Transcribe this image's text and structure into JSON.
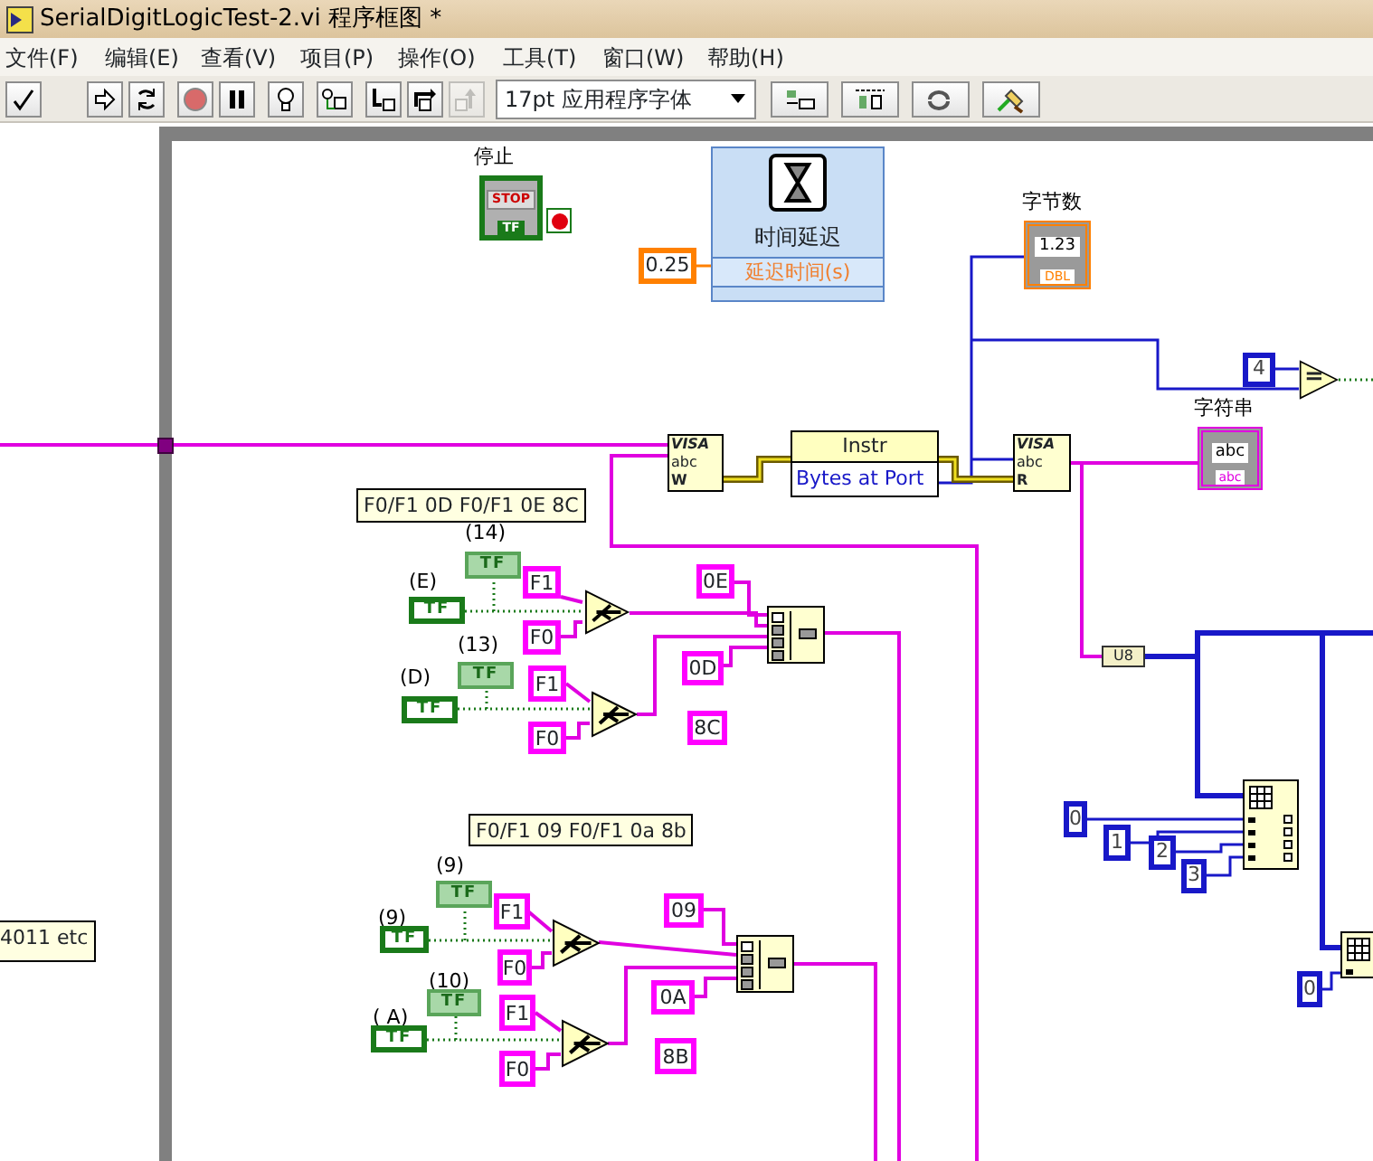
{
  "window": {
    "title": "SerialDigitLogicTest-2.vi 程序框图 *"
  },
  "menu": [
    "文件(F)",
    "编辑(E)",
    "查看(V)",
    "项目(P)",
    "操作(O)",
    "工具(T)",
    "窗口(W)",
    "帮助(H)"
  ],
  "toolbar": {
    "buttons": [
      {
        "kind": "check",
        "disabled": false
      },
      {
        "kind": "run",
        "disabled": false
      },
      {
        "kind": "run-continuous",
        "disabled": false
      },
      {
        "kind": "abort",
        "disabled": false
      },
      {
        "kind": "pause",
        "disabled": false
      },
      {
        "kind": "highlight",
        "disabled": false
      },
      {
        "kind": "retain",
        "disabled": false
      },
      {
        "kind": "step-into",
        "disabled": false
      },
      {
        "kind": "step-over",
        "disabled": false
      },
      {
        "kind": "step-out",
        "disabled": true
      }
    ],
    "font": "17pt 应用程序字体",
    "tools": [
      {
        "kind": "align"
      },
      {
        "kind": "distribute"
      },
      {
        "kind": "reorder"
      },
      {
        "kind": "cleanup"
      }
    ]
  },
  "diagram": {
    "nodes": [
      {
        "kind": "label",
        "text": "停止"
      },
      {
        "kind": "stop",
        "text": "STOP",
        "tag": "TF"
      },
      {
        "kind": "num-const",
        "text": "0.25"
      },
      {
        "kind": "express",
        "text": "时间延迟",
        "input": "延迟时间(s)"
      },
      {
        "kind": "label",
        "text": "字节数"
      },
      {
        "kind": "num-ind",
        "text": "1.23",
        "tag": "DBL"
      },
      {
        "kind": "int-const",
        "text": "4"
      },
      {
        "kind": "equal",
        "text": "="
      },
      {
        "kind": "label",
        "text": "字符串"
      },
      {
        "kind": "visa",
        "lines": [
          "VISA",
          "abc",
          "W"
        ]
      },
      {
        "kind": "property",
        "text": "Instr",
        "input": "Bytes at Port"
      },
      {
        "kind": "visa",
        "lines": [
          "VISA",
          "abc",
          "R"
        ]
      },
      {
        "kind": "str-ind",
        "text": "abc",
        "tag": "abc"
      },
      {
        "kind": "comment",
        "text": "F0/F1 0D F0/F1 0E 8C"
      },
      {
        "kind": "label",
        "text": "(14)"
      },
      {
        "kind": "bool-local",
        "text": "TF"
      },
      {
        "kind": "label",
        "text": "(E)"
      },
      {
        "kind": "bool-control",
        "text": "TF"
      },
      {
        "kind": "str-const",
        "text": "F1"
      },
      {
        "kind": "select"
      },
      {
        "kind": "str-const",
        "text": "0E"
      },
      {
        "kind": "concat"
      },
      {
        "kind": "str-const",
        "text": "F0"
      },
      {
        "kind": "label",
        "text": "(13)"
      },
      {
        "kind": "bool-local",
        "text": "TF"
      },
      {
        "kind": "str-const",
        "text": "F1"
      },
      {
        "kind": "str-const",
        "text": "0D"
      },
      {
        "kind": "label",
        "text": "(D)"
      },
      {
        "kind": "bool-control",
        "text": "TF"
      },
      {
        "kind": "select"
      },
      {
        "kind": "str-const",
        "text": "8C"
      },
      {
        "kind": "str-const",
        "text": "F0"
      },
      {
        "kind": "convert",
        "text": "U8"
      },
      {
        "kind": "index-array"
      },
      {
        "kind": "int-const",
        "text": "0"
      },
      {
        "kind": "int-const",
        "text": "1"
      },
      {
        "kind": "int-const",
        "text": "2"
      },
      {
        "kind": "int-const",
        "text": "3"
      },
      {
        "kind": "comment",
        "text": "F0/F1 09 F0/F1 0a 8b"
      },
      {
        "kind": "label",
        "text": "(9)"
      },
      {
        "kind": "bool-local",
        "text": "TF"
      },
      {
        "kind": "str-const",
        "text": "F1"
      },
      {
        "kind": "str-const",
        "text": "09"
      },
      {
        "kind": "label",
        "text": "(9)"
      },
      {
        "kind": "comment",
        "text": "4011 etc"
      },
      {
        "kind": "bool-control",
        "text": "TF"
      },
      {
        "kind": "select"
      },
      {
        "kind": "concat"
      },
      {
        "kind": "index-array"
      },
      {
        "kind": "str-const",
        "text": "F0"
      },
      {
        "kind": "label",
        "text": "(10)"
      },
      {
        "kind": "bool-local",
        "text": "TF"
      },
      {
        "kind": "str-const",
        "text": "0A"
      },
      {
        "kind": "int-const",
        "text": "0"
      },
      {
        "kind": "str-const",
        "text": "F1"
      },
      {
        "kind": "label",
        "text": "( A)"
      },
      {
        "kind": "select"
      },
      {
        "kind": "bool-control",
        "text": "TF"
      },
      {
        "kind": "str-const",
        "text": "8B"
      },
      {
        "kind": "str-const",
        "text": "F0"
      }
    ]
  }
}
